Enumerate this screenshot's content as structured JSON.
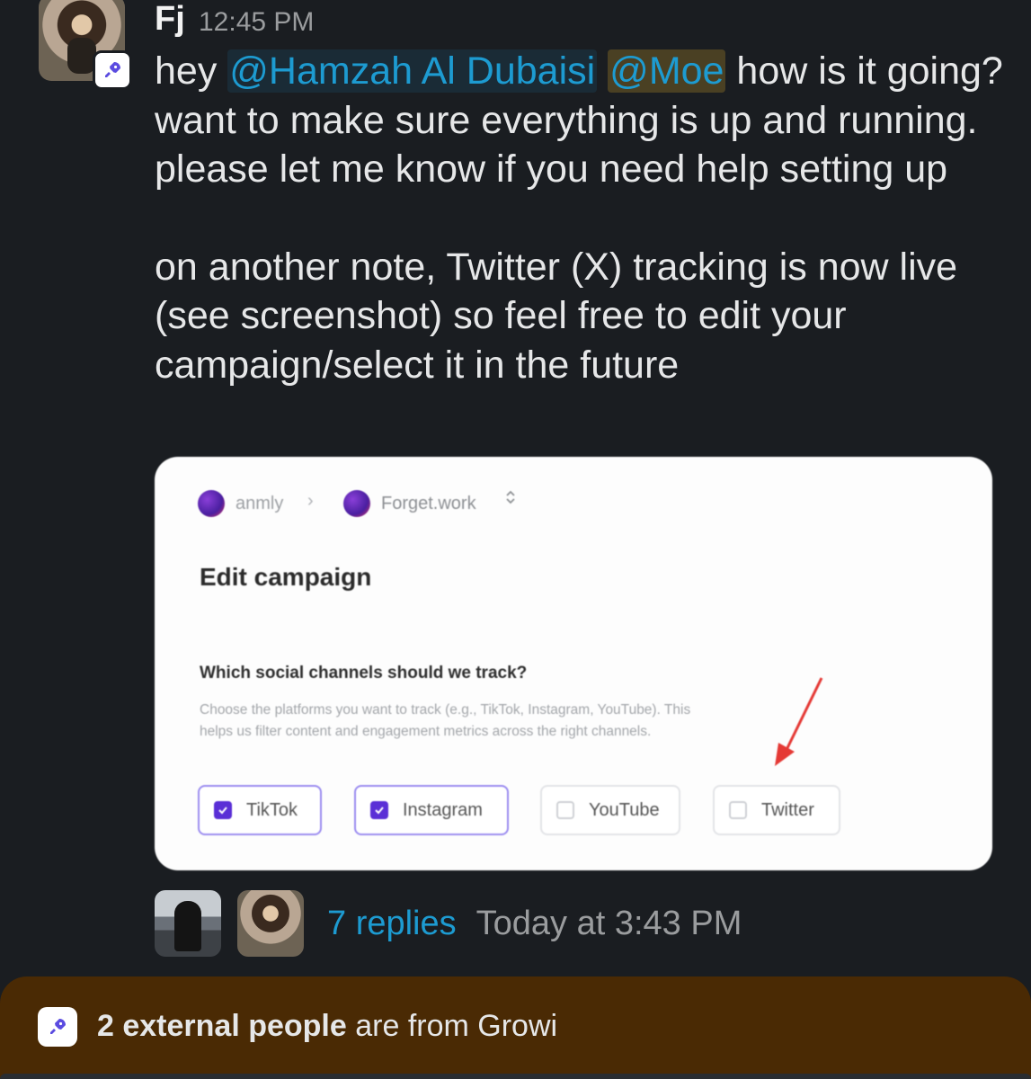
{
  "message": {
    "sender": "Fj",
    "time": "12:45 PM",
    "line1_prefix": "hey ",
    "mention1": "@Hamzah Al Dubaisi",
    "mention2": "@Moe",
    "line1_suffix": " how is it going? want to make sure everything is up and running. please let me know if you need help setting up",
    "paragraph2": "on another note, Twitter (X) tracking is now live (see screenshot) so feel free to edit your campaign/select it in the future"
  },
  "screenshot": {
    "breadcrumb": {
      "org": "anmly",
      "separator": "›",
      "workspace": "Forget.work"
    },
    "title": "Edit campaign",
    "question": "Which social channels should we track?",
    "description": "Choose the platforms you want to track (e.g., TikTok, Instagram, YouTube). This helps us filter content and engagement metrics across the right channels.",
    "channels": [
      {
        "label": "TikTok",
        "checked": true
      },
      {
        "label": "Instagram",
        "checked": true
      },
      {
        "label": "YouTube",
        "checked": false
      },
      {
        "label": "Twitter",
        "checked": false
      }
    ],
    "arrow_color": "#e53935"
  },
  "thread": {
    "replies": "7 replies",
    "last_reply": "Today at 3:43 PM"
  },
  "banner": {
    "bold": "2 external people",
    "rest": " are from Growi"
  },
  "colors": {
    "background": "#1a1d21",
    "link": "#1d9bd1",
    "banner": "#4a2a04",
    "checkbox": "#5a2fd6"
  },
  "icons": {
    "app_badge": "rocket-icon",
    "checkbox": "check-icon",
    "selector": "chevron-updown-icon"
  }
}
